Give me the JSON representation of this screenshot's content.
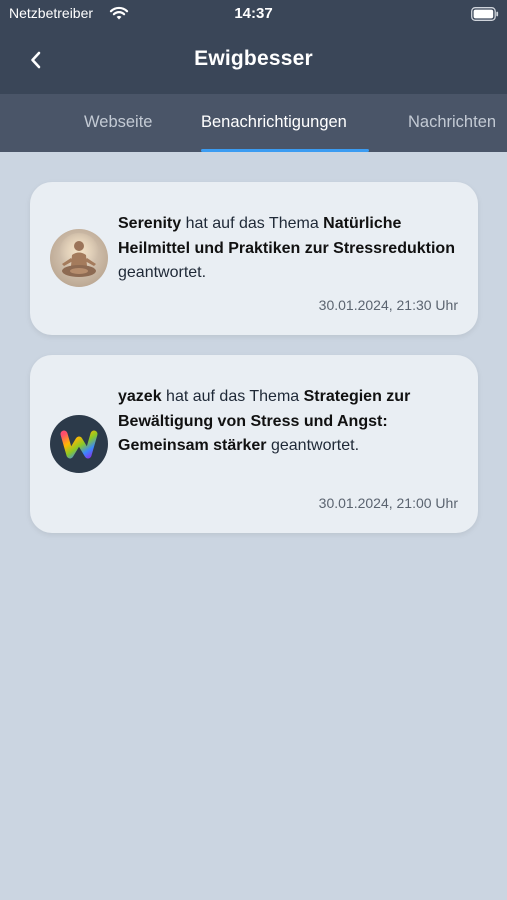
{
  "status_bar": {
    "carrier": "Netzbetreiber",
    "time": "14:37"
  },
  "header": {
    "title": "Ewigbesser"
  },
  "tabs": [
    {
      "label": "Webseite",
      "active": false
    },
    {
      "label": "Benachrichtigungen",
      "active": true
    },
    {
      "label": "Nachrichten",
      "active": false
    }
  ],
  "notifications": [
    {
      "user": "Serenity",
      "text_before_topic": " hat auf das Thema ",
      "topic": "Natürliche Heilmittel und Praktiken zur Stressreduktion",
      "text_after": " geantwortet.",
      "timestamp": "30.01.2024, 21:30 Uhr",
      "avatar": "meditation-avatar"
    },
    {
      "user": "yazek",
      "text_before_topic": " hat auf das Thema ",
      "topic": "Strategien zur Bewältigung von Stress und Angst: Gemeinsam stärker",
      "text_after": " geantwortet.",
      "timestamp": "30.01.2024, 21:00 Uhr",
      "avatar": "rainbow-w-logo"
    }
  ],
  "colors": {
    "header_bg": "#3a4658",
    "tabbar_bg": "#4a5568",
    "indicator": "#3b9cf2",
    "page_bg": "#cbd5e1",
    "card_bg": "#e9eef3"
  }
}
